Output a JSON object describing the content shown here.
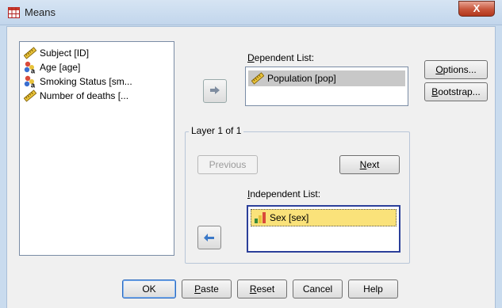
{
  "window": {
    "title": "Means",
    "close_label": "X"
  },
  "source_list": {
    "items": [
      {
        "label": "Subject [ID]",
        "icon": "ruler-scale-icon"
      },
      {
        "label": "Age [age]",
        "icon": "nominal-variable-icon"
      },
      {
        "label": "Smoking Status [sm...",
        "icon": "nominal-variable-icon"
      },
      {
        "label": "Number of deaths [...",
        "icon": "ruler-scale-icon"
      }
    ]
  },
  "dependent": {
    "label_prefix": "",
    "label_underline": "D",
    "label_rest": "ependent List:",
    "items": [
      {
        "label": "Population [pop]",
        "icon": "ruler-scale-icon"
      }
    ]
  },
  "layer": {
    "legend": "Layer 1 of 1",
    "previous_label": "Previous",
    "next_underline": "N",
    "next_rest": "ext"
  },
  "independent": {
    "label_underline": "I",
    "label_rest": "ndependent List:",
    "items": [
      {
        "label": "Sex [sex]",
        "icon": "bar-chart-variable-icon"
      }
    ]
  },
  "side_buttons": {
    "options_underline": "O",
    "options_rest": "ptions...",
    "bootstrap_underline": "B",
    "bootstrap_rest": "ootstrap..."
  },
  "bottom_buttons": {
    "ok": "OK",
    "paste_underline": "P",
    "paste_rest": "aste",
    "reset_underline": "R",
    "reset_rest": "eset",
    "cancel": "Cancel",
    "help": "Help"
  },
  "colors": {
    "title_bar": "#c9dbee",
    "dialog_bg": "#f0f0f0",
    "selected_row": "#c8c8c8",
    "independent_row": "#fae27a",
    "arrow_blue": "#3a78c8"
  }
}
